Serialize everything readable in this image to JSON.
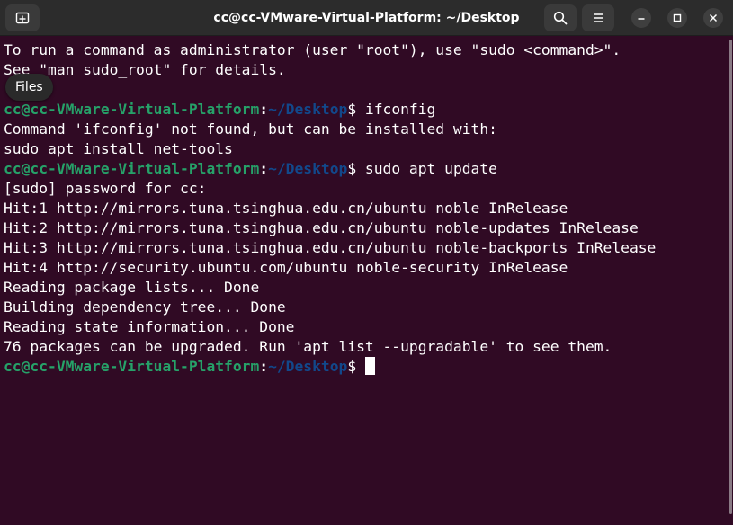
{
  "window": {
    "title": "cc@cc-VMware-Virtual-Platform: ~/Desktop"
  },
  "header": {
    "new_tab_icon": "new-tab-icon",
    "search_icon": "search-icon",
    "menu_icon": "hamburger-menu-icon",
    "minimize_icon": "minimize-icon",
    "maximize_icon": "maximize-icon",
    "close_icon": "close-icon"
  },
  "tooltip": {
    "label": "Files"
  },
  "colors": {
    "background": "#300a24",
    "prompt_user": "#26a269",
    "prompt_path": "#12488b",
    "text": "#ffffff"
  },
  "terminal": {
    "prompt_user": "cc@cc-VMware-Virtual-Platform",
    "prompt_colon": ":",
    "prompt_path": "~/Desktop",
    "prompt_symbol": "$ ",
    "lines": [
      {
        "type": "text",
        "text": "To run a command as administrator (user \"root\"), use \"sudo <command>\"."
      },
      {
        "type": "text",
        "text": "See \"man sudo_root\" for details."
      },
      {
        "type": "text",
        "text": ""
      },
      {
        "type": "prompt",
        "text": "ifconfig"
      },
      {
        "type": "text",
        "text": "Command 'ifconfig' not found, but can be installed with:"
      },
      {
        "type": "text",
        "text": "sudo apt install net-tools"
      },
      {
        "type": "prompt",
        "text": "sudo apt update"
      },
      {
        "type": "text",
        "text": "[sudo] password for cc:"
      },
      {
        "type": "text",
        "text": "Hit:1 http://mirrors.tuna.tsinghua.edu.cn/ubuntu noble InRelease"
      },
      {
        "type": "text",
        "text": "Hit:2 http://mirrors.tuna.tsinghua.edu.cn/ubuntu noble-updates InRelease"
      },
      {
        "type": "text",
        "text": "Hit:3 http://mirrors.tuna.tsinghua.edu.cn/ubuntu noble-backports InRelease"
      },
      {
        "type": "text",
        "text": "Hit:4 http://security.ubuntu.com/ubuntu noble-security InRelease"
      },
      {
        "type": "text",
        "text": "Reading package lists... Done"
      },
      {
        "type": "text",
        "text": "Building dependency tree... Done"
      },
      {
        "type": "text",
        "text": "Reading state information... Done"
      },
      {
        "type": "text",
        "text": "76 packages can be upgraded. Run 'apt list --upgradable' to see them."
      },
      {
        "type": "prompt",
        "text": "",
        "cursor": true
      }
    ]
  }
}
